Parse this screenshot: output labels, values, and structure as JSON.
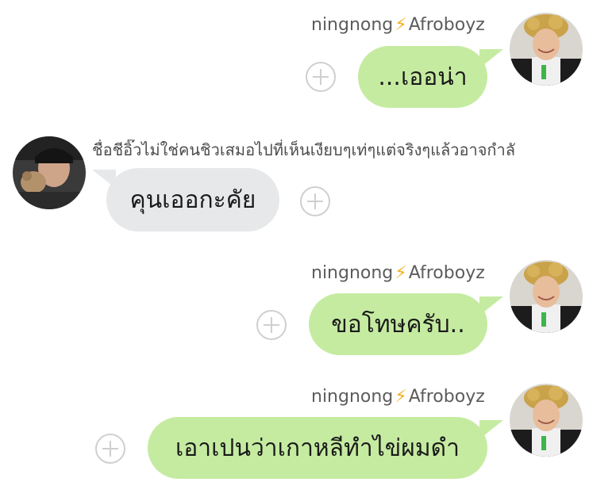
{
  "messages": [
    {
      "side": "right",
      "sender": {
        "name": "ningnong",
        "group": "Afroboyz",
        "icon": "lightning-icon"
      },
      "text": "...เออน่า",
      "bubble_color": "#c5eba1"
    },
    {
      "side": "left",
      "sender": {
        "name": "ชื่อชีอิ๊วไม่ใช่คนชิวเสมอไปที่เห็นเงียบๆเท่ๆแต่จริงๆแล้วอาจกำลั"
      },
      "text": "คุนเออกะคัย",
      "bubble_color": "#e6e8ea"
    },
    {
      "side": "right",
      "sender": {
        "name": "ningnong",
        "group": "Afroboyz",
        "icon": "lightning-icon"
      },
      "text": "ขอโทษครับ..",
      "bubble_color": "#c5eba1"
    },
    {
      "side": "right",
      "sender": {
        "name": "ningnong",
        "group": "Afroboyz",
        "icon": "lightning-icon"
      },
      "text": "เอาเปนว่าเกาหลีทำไข่ผมดำ",
      "bubble_color": "#c5eba1"
    }
  ],
  "icons": {
    "bolt": "⚡",
    "add": "plus-circle-icon"
  }
}
